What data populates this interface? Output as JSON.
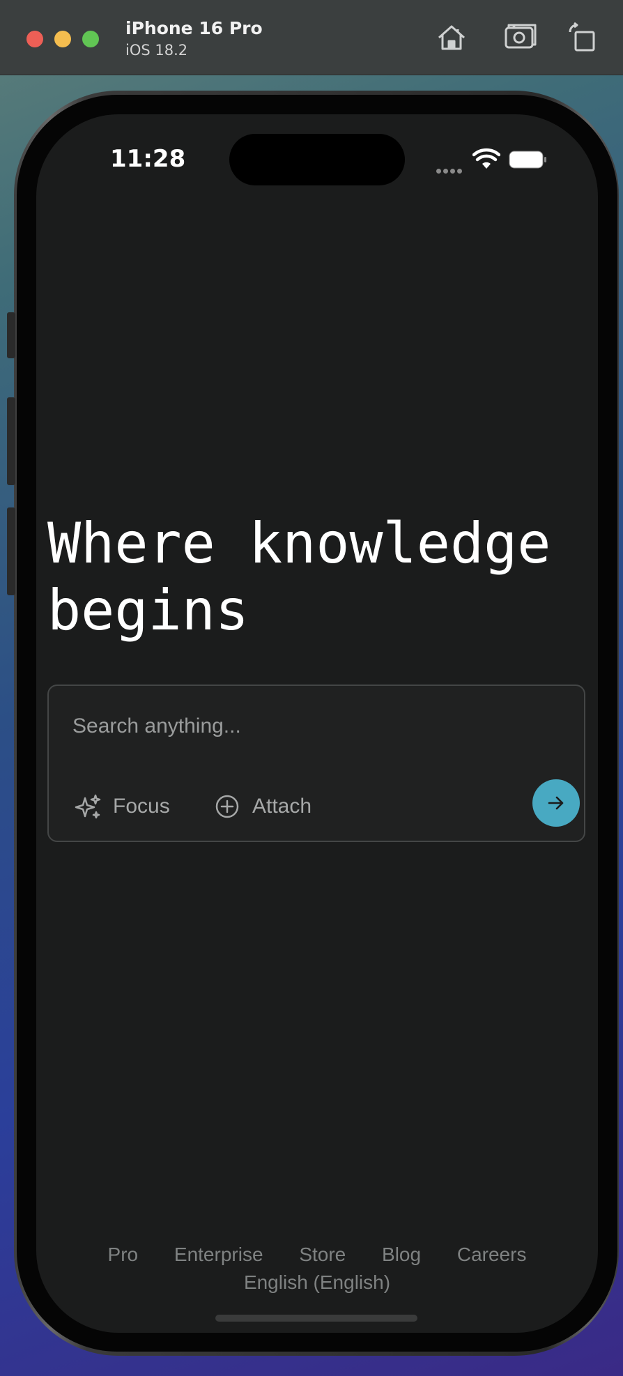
{
  "simulator": {
    "device_name": "iPhone 16 Pro",
    "os_version": "iOS 18.2",
    "toolbar_icons": [
      "home-icon",
      "screenshot-icon",
      "rotate-icon"
    ]
  },
  "status_bar": {
    "time": "11:28",
    "icons": [
      "cellular-icon",
      "wifi-icon",
      "battery-icon"
    ]
  },
  "hero": {
    "title_line1": "Where knowledge",
    "title_line2": "begins"
  },
  "search": {
    "placeholder": "Search anything...",
    "focus_label": "Focus",
    "attach_label": "Attach",
    "submit_icon": "arrow-right-icon",
    "accent_color": "#48a9c2"
  },
  "footer": {
    "links": [
      "Pro",
      "Enterprise",
      "Store",
      "Blog",
      "Careers"
    ],
    "language": "English (English)"
  }
}
